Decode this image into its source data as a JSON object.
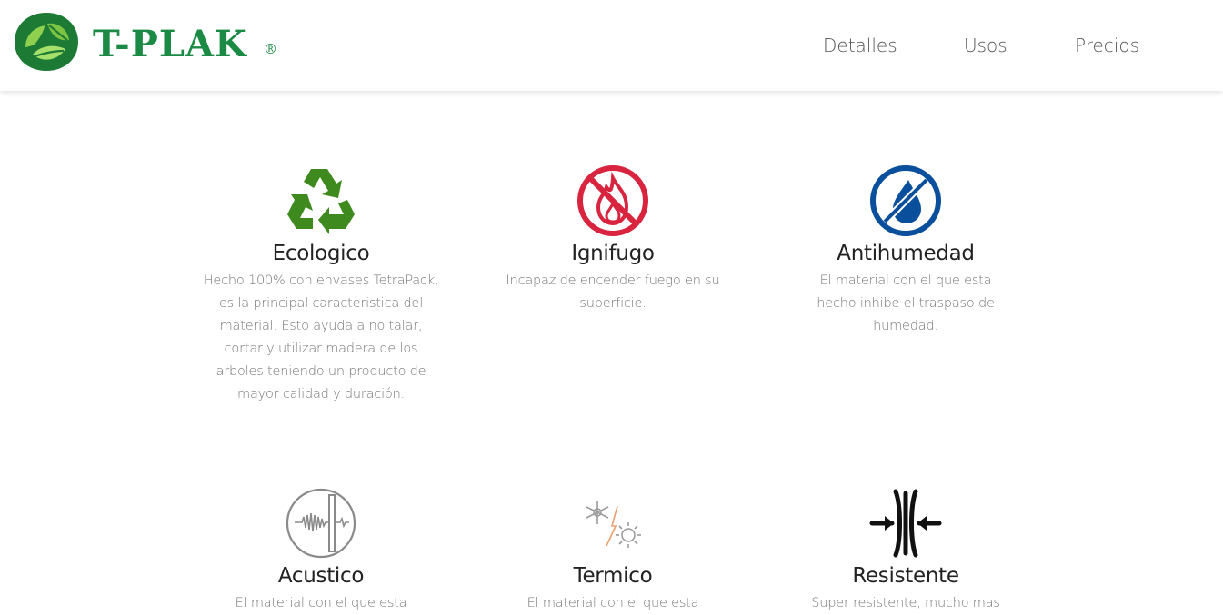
{
  "brand": {
    "name": "T-PLAK",
    "registered": "®",
    "color": "#1a8a45"
  },
  "nav": {
    "items": [
      "Detalles",
      "Usos",
      "Precios"
    ]
  },
  "features": [
    {
      "title": "Ecologico",
      "icon": "recycle-icon",
      "color": "#3f8a1e",
      "text": "Hecho 100% con envases TetraPack, es la principal caracteristica del material. Esto ayuda a no talar, cortar y utilizar madera de los arboles teniendo un producto de mayor calidad y duración."
    },
    {
      "title": "Ignifugo",
      "icon": "no-fire-icon",
      "color": "#d9243f",
      "text": "Incapaz de encender fuego en su superficie."
    },
    {
      "title": "Antihumedad",
      "icon": "no-water-icon",
      "color": "#0a4f9c",
      "text": "El material con el que esta hecho inhibe el traspaso de humedad."
    },
    {
      "title": "Acustico",
      "icon": "acoustic-wave-icon",
      "color": "#8a8a8a",
      "text": "El material con el que esta"
    },
    {
      "title": "Termico",
      "icon": "snowflake-sun-icon",
      "color": "#9a9a9a",
      "text": "El material con el que esta"
    },
    {
      "title": "Resistente",
      "icon": "compression-arrows-icon",
      "color": "#111111",
      "text": "Super resistente, mucho mas"
    }
  ]
}
